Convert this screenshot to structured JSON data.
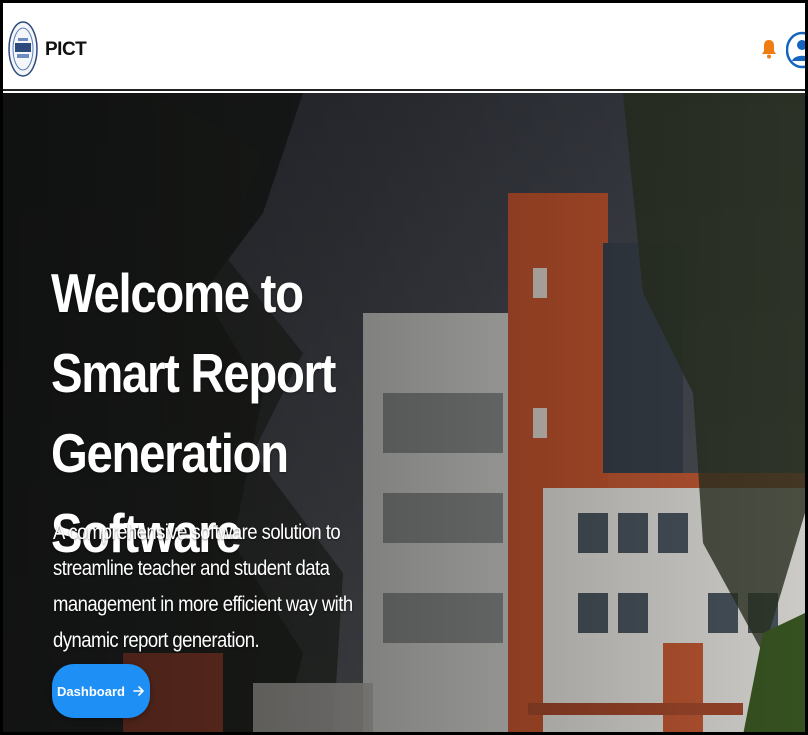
{
  "navbar": {
    "brand": "PICT",
    "logo_icon": "pict-logo-icon",
    "notification_icon": "bell-icon",
    "notification_color": "#f07d12",
    "profile_icon": "user-avatar-icon",
    "profile_color": "#1565c0"
  },
  "hero": {
    "title": "Welcome to Smart Report Generation Software",
    "subtitle": "A comprehensive software solution to streamline teacher and student data management in more efficient way with dynamic report generation.",
    "cta_label": "Dashboard",
    "cta_icon": "arrow-right-icon",
    "cta_color": "#1e8ff5"
  }
}
